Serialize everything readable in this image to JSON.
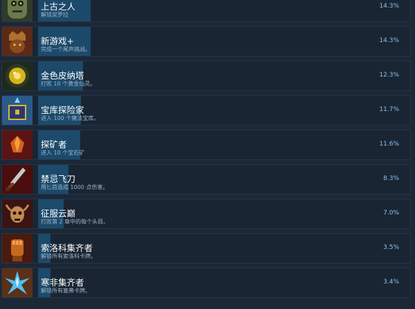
{
  "achievements": [
    {
      "title": "上古之人",
      "desc": "解锁吴罗拉",
      "percent": "14.3%",
      "fill": 0.143,
      "icon": "ancient-mask-icon",
      "colors": [
        "#2f3a2b",
        "#6a7a4a"
      ]
    },
    {
      "title": "新游戏+",
      "desc": "完成一个尾声挑战。",
      "percent": "14.3%",
      "fill": 0.143,
      "icon": "crowned-figure-icon",
      "colors": [
        "#3a1f18",
        "#7a4628"
      ]
    },
    {
      "title": "金色皮纳塔",
      "desc": "打败 10 个黄金仙灵。",
      "percent": "12.3%",
      "fill": 0.123,
      "icon": "golden-orb-icon",
      "colors": [
        "#1e2a1e",
        "#d6b21c"
      ]
    },
    {
      "title": "宝库探险家",
      "desc": "进入 100 个魔法宝库。",
      "percent": "11.7%",
      "fill": 0.117,
      "icon": "treasure-chest-icon",
      "colors": [
        "#1f3550",
        "#4fa8d8"
      ]
    },
    {
      "title": "探矿者",
      "desc": "进入 10 个宝石矿",
      "percent": "11.6%",
      "fill": 0.116,
      "icon": "ore-gem-icon",
      "colors": [
        "#4a1010",
        "#d8601c"
      ]
    },
    {
      "title": "禁忌飞刀",
      "desc": "用匕首造成 1000 点伤害。",
      "percent": "8.3%",
      "fill": 0.083,
      "icon": "dagger-icon",
      "colors": [
        "#3a0c0c",
        "#c8c8c8"
      ]
    },
    {
      "title": "征服云巅",
      "desc": "打败第 2 章中的每个头目。",
      "percent": "7.0%",
      "fill": 0.07,
      "icon": "horned-skull-icon",
      "colors": [
        "#2a0d0d",
        "#c08a50"
      ]
    },
    {
      "title": "索洛科集齐者",
      "desc": "解锁所有索洛科卡牌。",
      "percent": "3.5%",
      "fill": 0.035,
      "icon": "fist-card-icon",
      "colors": [
        "#3a1010",
        "#c86820"
      ]
    },
    {
      "title": "寒非集齐者",
      "desc": "解锁所有塞弗卡牌。",
      "percent": "3.4%",
      "fill": 0.034,
      "icon": "ice-shard-icon",
      "colors": [
        "#5a3018",
        "#4fc0f0"
      ]
    }
  ]
}
